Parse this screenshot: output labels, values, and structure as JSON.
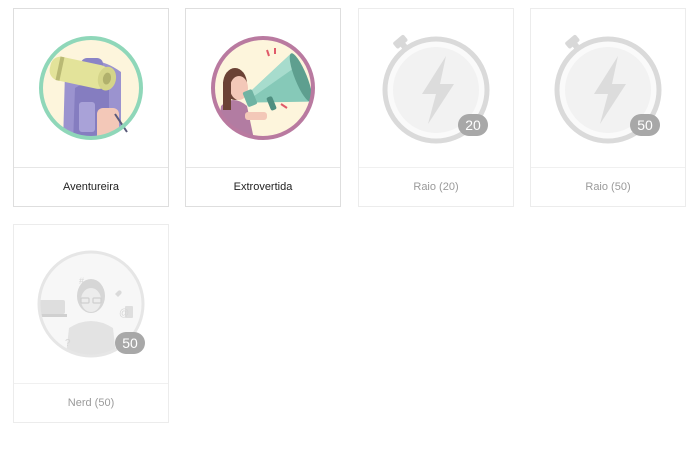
{
  "badges": [
    {
      "name": "Aventureira",
      "earned": true,
      "icon": "backpack-icon",
      "ring_color": "#8fd7b9"
    },
    {
      "name": "Extrovertida",
      "earned": true,
      "icon": "megaphone-icon",
      "ring_color": "#b97aa0"
    },
    {
      "name": "Raio (20)",
      "earned": false,
      "icon": "lightning-stopwatch-icon",
      "count": "20"
    },
    {
      "name": "Raio (50)",
      "earned": false,
      "icon": "lightning-stopwatch-icon",
      "count": "50"
    },
    {
      "name": "Nerd (50)",
      "earned": false,
      "icon": "nerd-girl-icon",
      "count": "50"
    }
  ],
  "colors": {
    "earned_label": "#222222",
    "locked_label": "#9a9a9a",
    "locked_gray": "#d8d8d8",
    "count_pill": "#a8a8a8"
  }
}
